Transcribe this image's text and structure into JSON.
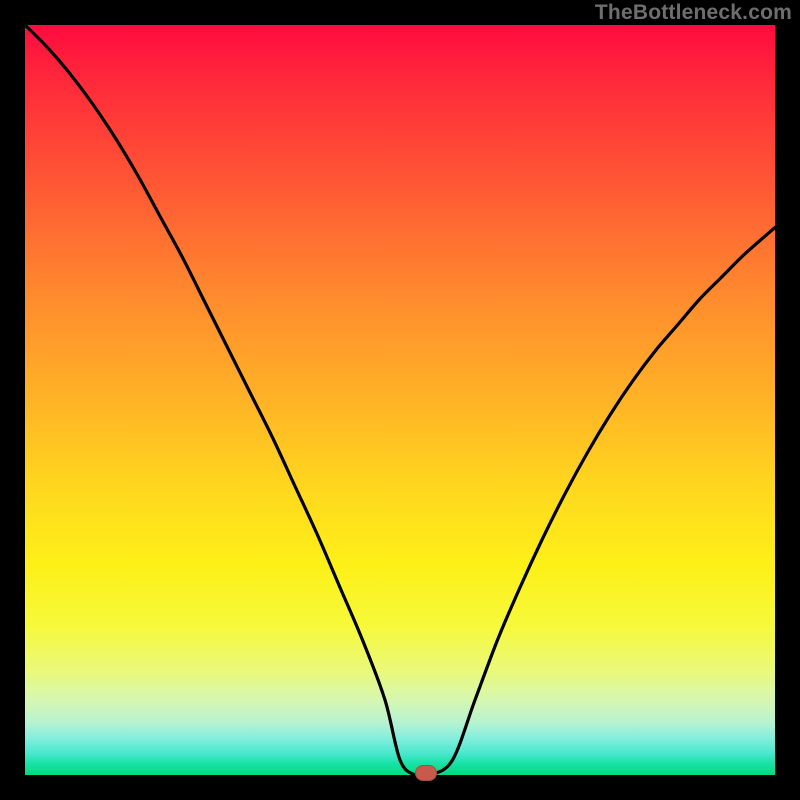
{
  "watermark": "TheBottleneck.com",
  "colors": {
    "page_bg": "#000000",
    "curve": "#000000",
    "trough_marker": "#c75a4a",
    "gradient_top": "#ff0b3f",
    "gradient_bottom": "#00db7e"
  },
  "chart_data": {
    "type": "line",
    "title": "",
    "xlabel": "",
    "ylabel": "",
    "xlim": [
      0,
      100
    ],
    "ylim": [
      0,
      100
    ],
    "grid": false,
    "legend": false,
    "x": [
      0,
      3,
      6,
      9,
      12,
      15,
      18,
      21,
      24,
      27,
      30,
      33,
      36,
      39,
      42,
      45,
      48,
      50,
      52,
      54,
      57,
      60,
      63,
      66,
      69,
      72,
      75,
      78,
      81,
      84,
      87,
      90,
      93,
      96,
      100
    ],
    "y": [
      100,
      97,
      93.5,
      89.5,
      85,
      80,
      74.5,
      69,
      63,
      57,
      51,
      45,
      38.5,
      32,
      25,
      18,
      10,
      2,
      0,
      0,
      2,
      10,
      18,
      25,
      31.5,
      37.5,
      43,
      48,
      52.5,
      56.5,
      60,
      63.5,
      66.5,
      69.5,
      73
    ],
    "trough": {
      "x": 53.5,
      "y": 0
    },
    "notes": "Values read visually; y-axis is implied percent scale from 0 (bottom/green) to 100 (top/red). Single black V-shaped curve with left branch starting at top-left descending steeply, slightly convex; right branch rising from trough near x≈54, concave, ending near y≈73 at the right edge. A small rounded red-brown marker sits at the trough on the baseline."
  }
}
